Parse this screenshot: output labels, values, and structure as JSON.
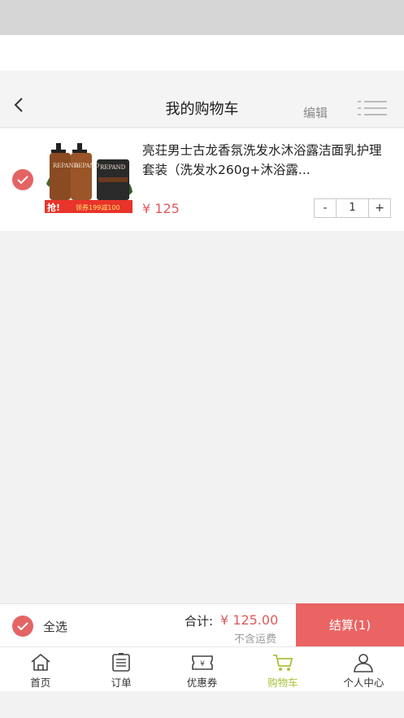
{
  "header": {
    "title": "我的购物车",
    "edit_label": "编辑",
    "back_icon": "chevron-left-icon",
    "menu_icon": "list-menu-icon"
  },
  "cart_item": {
    "title": "亮荘男士古龙香氛洗发水沐浴露洁面乳护理套装（洗发水260g+沐浴露...",
    "price": "¥ 125",
    "quantity": "1",
    "decrease_label": "-",
    "increase_label": "+",
    "checked": true,
    "image_banner_left": "抢!",
    "image_banner_right": "领券199减100",
    "image_brand": "REPAND"
  },
  "checkout": {
    "select_all_label": "全选",
    "total_label": "合计:",
    "total_value": "¥ 125.00",
    "shipping_note": "不含运费",
    "checkout_label": "结算(1)"
  },
  "tabs": [
    {
      "label": "首页",
      "icon": "home-icon"
    },
    {
      "label": "订单",
      "icon": "order-icon"
    },
    {
      "label": "优惠券",
      "icon": "coupon-icon"
    },
    {
      "label": "购物车",
      "icon": "cart-icon",
      "active": true
    },
    {
      "label": "个人中心",
      "icon": "person-icon"
    }
  ],
  "colors": {
    "accent": "#ea6464",
    "price": "#e05a5a",
    "active_tab": "#a7c23a"
  }
}
